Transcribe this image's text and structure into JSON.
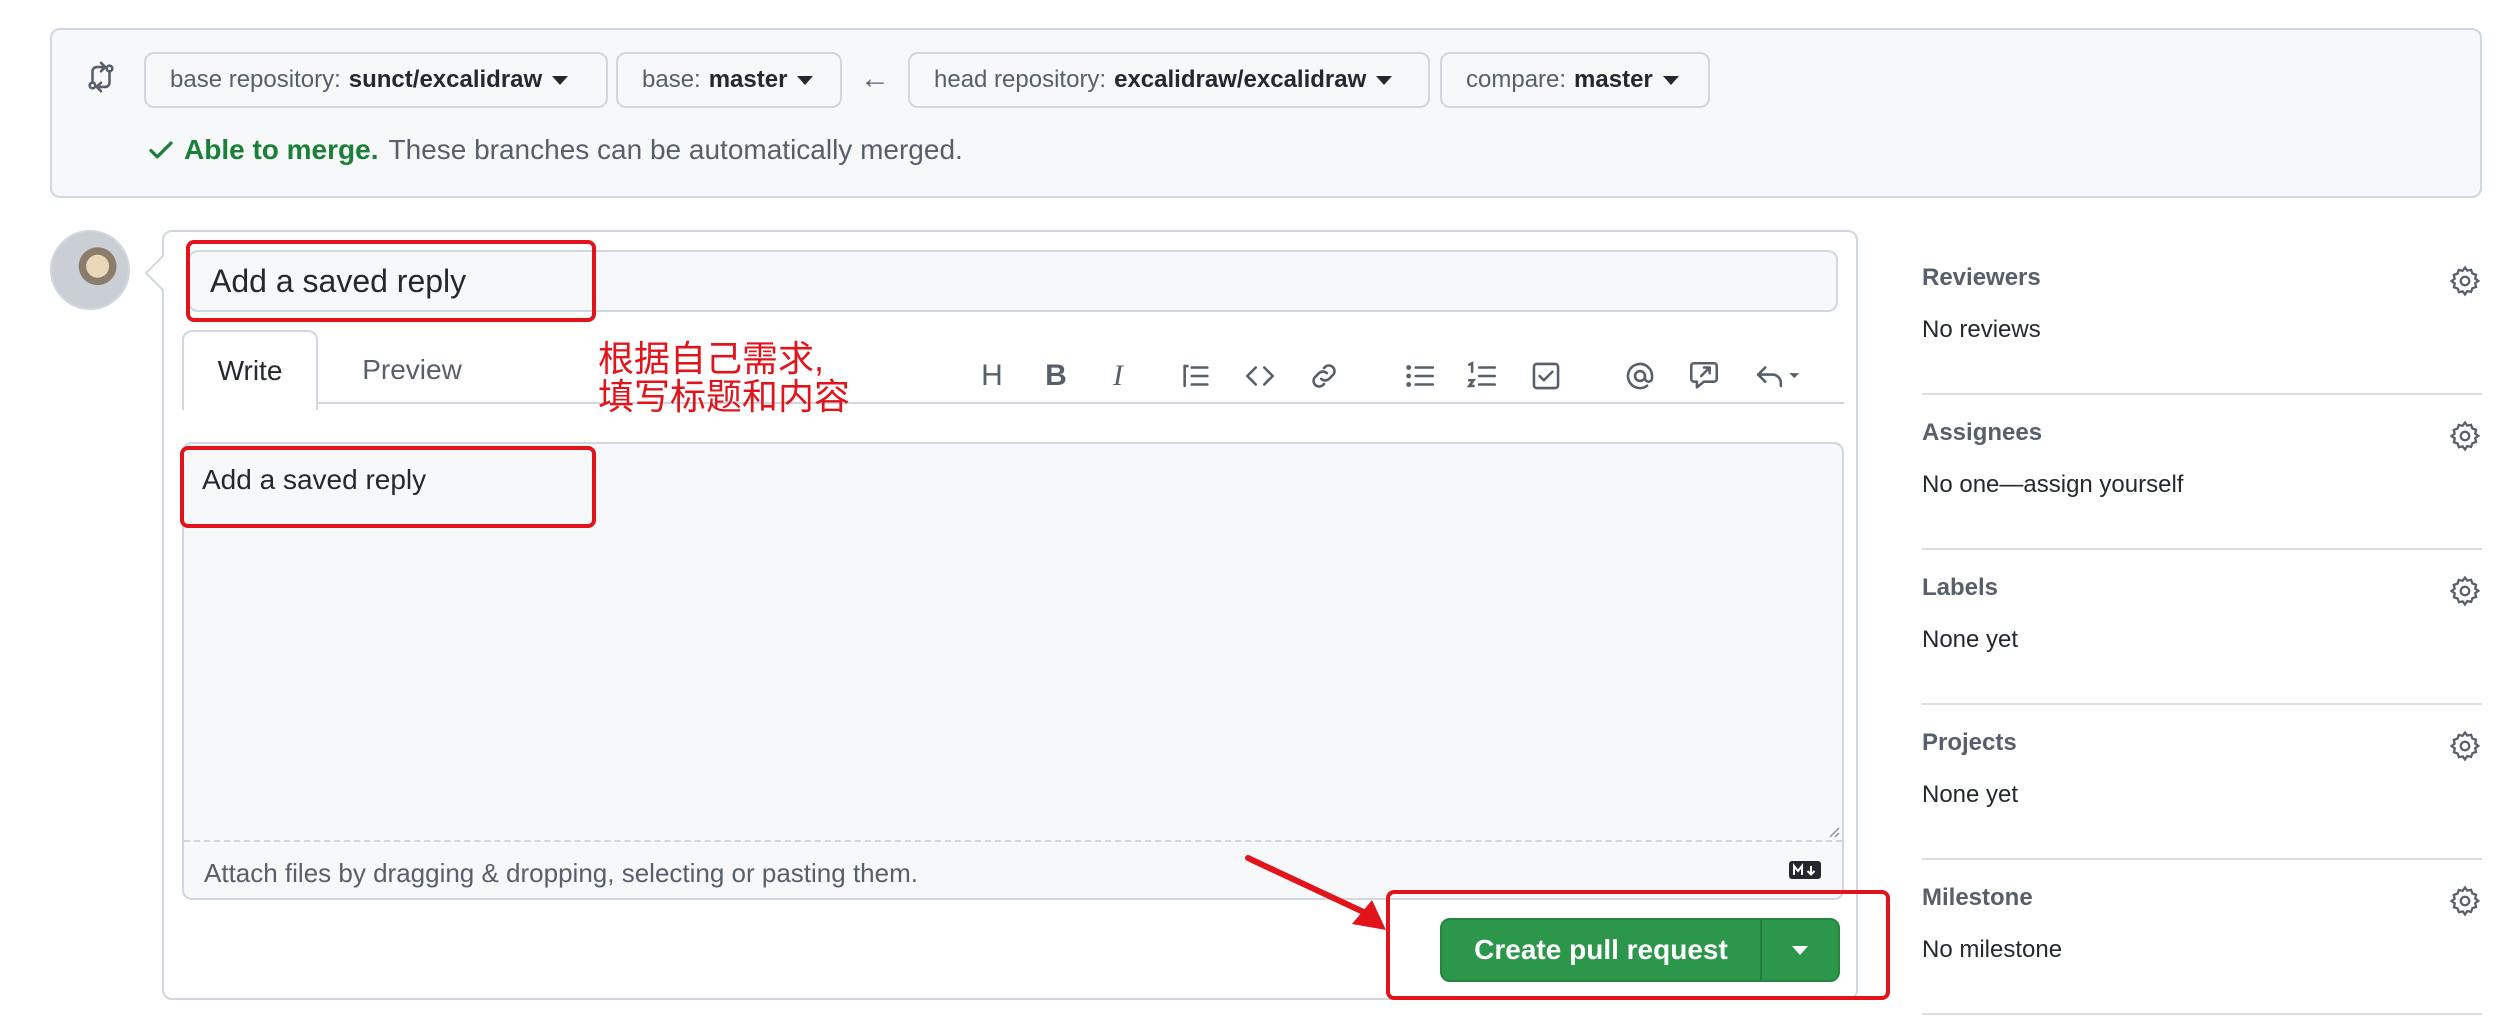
{
  "compare": {
    "base_repo_label": "base repository:",
    "base_repo_value": "sunct/excalidraw",
    "base_label": "base:",
    "base_value": "master",
    "head_repo_label": "head repository:",
    "head_repo_value": "excalidraw/excalidraw",
    "compare_label": "compare:",
    "compare_value": "master",
    "merge_ok": "Able to merge.",
    "merge_msg": "These branches can be automatically merged."
  },
  "form": {
    "title_value": "Add a saved reply",
    "tabs": [
      {
        "label": "Write",
        "active": true
      },
      {
        "label": "Preview",
        "active": false
      }
    ],
    "toolbar_icons": [
      "heading-icon",
      "bold-icon",
      "italic-icon",
      "quote-icon",
      "code-icon",
      "link-icon",
      "unordered-list-icon",
      "ordered-list-icon",
      "task-list-icon",
      "mention-icon",
      "reference-icon",
      "saved-reply-icon"
    ],
    "body_value": "Add a saved reply",
    "attach_hint": "Attach files by dragging & dropping, selecting or pasting them.",
    "submit_label": "Create pull request"
  },
  "sidebar": {
    "sections": [
      {
        "title": "Reviewers",
        "value": "No reviews"
      },
      {
        "title": "Assignees",
        "value": "No one—assign yourself"
      },
      {
        "title": "Labels",
        "value": "None yet"
      },
      {
        "title": "Projects",
        "value": "None yet"
      },
      {
        "title": "Milestone",
        "value": "No milestone"
      }
    ]
  },
  "annotation": {
    "line1": "根据自己需求,",
    "line2": "填写标题和内容",
    "color": "#e1141b"
  },
  "colors": {
    "accent_green": "#2c974b",
    "merge_green": "#1a7f37",
    "border": "#d0d7de"
  }
}
